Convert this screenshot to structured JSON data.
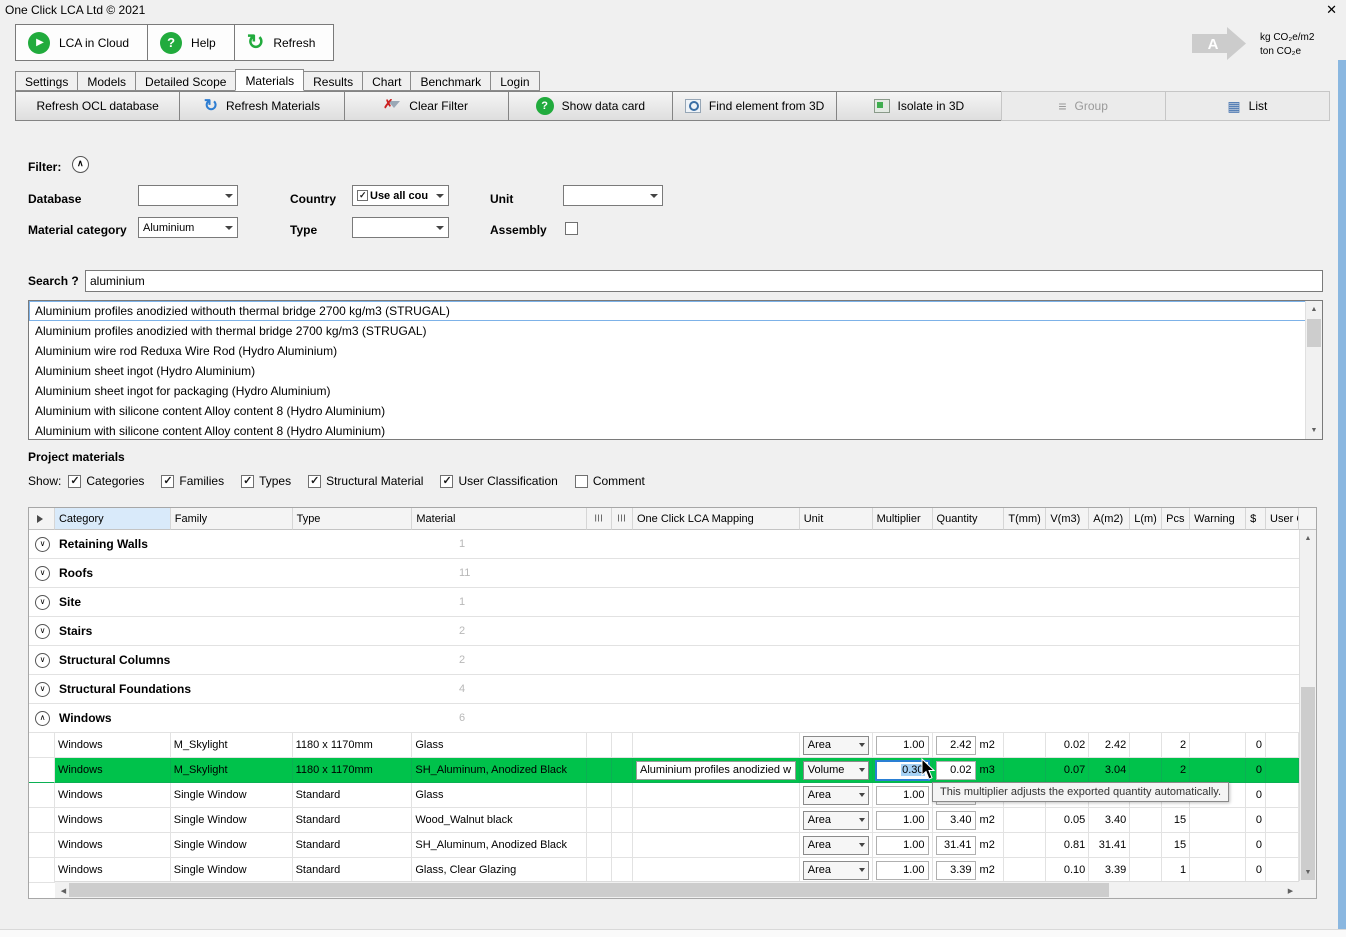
{
  "colors": {
    "brand_green": "#21ab3d",
    "row_highlight": "#00c24b",
    "focus_blue": "#2a7fd4",
    "strip_blue": "#8ab7e0"
  },
  "titlebar": {
    "title": "One Click LCA Ltd © 2021",
    "close_glyph": "✕"
  },
  "toolbar": {
    "lca_cloud_label": "LCA in Cloud",
    "help_label": "Help",
    "refresh_label": "Refresh",
    "logo_letter": "A",
    "unit_line_1": "kg CO₂e/m2",
    "unit_line_2": "ton CO₂e"
  },
  "tabs": {
    "settings": "Settings",
    "models": "Models",
    "detailed_scope": "Detailed Scope",
    "materials": "Materials",
    "results": "Results",
    "chart": "Chart",
    "benchmark": "Benchmark",
    "login": "Login"
  },
  "actions": {
    "refresh_ocl": "Refresh OCL database",
    "refresh_materials": "Refresh Materials",
    "clear_filter": "Clear Filter",
    "show_data_card": "Show data card",
    "find_element": "Find element from 3D",
    "isolate": "Isolate in 3D",
    "group": "Group",
    "list": "List"
  },
  "filter": {
    "section_label": "Filter:",
    "database_label": "Database",
    "database_value": "",
    "country_label": "Country",
    "country_value": "Use all cou",
    "unit_label": "Unit",
    "unit_value": "",
    "material_category_label": "Material category",
    "material_category_value": "Aluminium",
    "type_label": "Type",
    "type_value": "",
    "assembly_label": "Assembly"
  },
  "search": {
    "label": "Search ?",
    "value": "aluminium"
  },
  "results": [
    "Aluminium profiles anodizied withouth thermal bridge 2700 kg/m3 (STRUGAL)",
    "Aluminium profiles anodizied with thermal bridge 2700 kg/m3 (STRUGAL)",
    "Aluminium wire rod Reduxa Wire Rod (Hydro Aluminium)",
    "Aluminium sheet ingot (Hydro Aluminium)",
    "Aluminium sheet ingot for packaging (Hydro Aluminium)",
    "Aluminium with silicone content Alloy content  8 (Hydro Aluminium)",
    "Aluminium with silicone content Alloy content  8 (Hydro Aluminium)"
  ],
  "project": {
    "title": "Project materials",
    "show_label": "Show:",
    "toggle_categories": "Categories",
    "toggle_families": "Families",
    "toggle_types": "Types",
    "toggle_structural": "Structural Material",
    "toggle_user_class": "User Classification",
    "toggle_comment": "Comment"
  },
  "table": {
    "headers": {
      "category": "Category",
      "family": "Family",
      "type": "Type",
      "material": "Material",
      "flag1": "|||",
      "flag2": "|||",
      "mapping": "One Click LCA Mapping",
      "unit": "Unit",
      "multiplier": "Multiplier",
      "quantity": "Quantity",
      "t": "T(mm)",
      "v": "V(m3)",
      "a": "A(m2)",
      "l": "L(m)",
      "pcs": "Pcs",
      "warning": "Warning",
      "dollar": "$",
      "user": "User Cla"
    },
    "groups": [
      {
        "name": "Retaining Walls",
        "count": "1"
      },
      {
        "name": "Roofs",
        "count": "11"
      },
      {
        "name": "Site",
        "count": "1"
      },
      {
        "name": "Stairs",
        "count": "2"
      },
      {
        "name": "Structural Columns",
        "count": "2"
      },
      {
        "name": "Structural Foundations",
        "count": "4"
      },
      {
        "name": "Windows",
        "count": "6"
      }
    ],
    "rows": [
      {
        "category": "Windows",
        "family": "M_Skylight",
        "type": "1180 x 1170mm",
        "material": "Glass",
        "mapping": "",
        "unit": "Area",
        "multiplier": "1.00",
        "quantity": "2.42",
        "qunit": "m2",
        "t": "",
        "v": "0.02",
        "a": "2.42",
        "l": "",
        "pcs": "2",
        "warning": "",
        "dollar": "0"
      },
      {
        "category": "Windows",
        "family": "M_Skylight",
        "type": "1180 x 1170mm",
        "material": "SH_Aluminum, Anodized Black",
        "mapping": "Aluminium profiles anodizied w",
        "unit": "Volume",
        "multiplier": "0.30",
        "quantity": "0.02",
        "qunit": "m3",
        "t": "",
        "v": "0.07",
        "a": "3.04",
        "l": "",
        "pcs": "2",
        "warning": "",
        "dollar": "0"
      },
      {
        "category": "Windows",
        "family": "Single Window",
        "type": "Standard",
        "material": "Glass",
        "mapping": "",
        "unit": "Area",
        "multiplier": "1.00",
        "quantity": "",
        "qunit": "",
        "t": "",
        "v": "",
        "a": "",
        "l": "",
        "pcs": "",
        "warning": "",
        "dollar": "0"
      },
      {
        "category": "Windows",
        "family": "Single Window",
        "type": "Standard",
        "material": "Wood_Walnut black",
        "mapping": "",
        "unit": "Area",
        "multiplier": "1.00",
        "quantity": "3.40",
        "qunit": "m2",
        "t": "",
        "v": "0.05",
        "a": "3.40",
        "l": "",
        "pcs": "15",
        "warning": "",
        "dollar": "0"
      },
      {
        "category": "Windows",
        "family": "Single Window",
        "type": "Standard",
        "material": "SH_Aluminum, Anodized Black",
        "mapping": "",
        "unit": "Area",
        "multiplier": "1.00",
        "quantity": "31.41",
        "qunit": "m2",
        "t": "",
        "v": "0.81",
        "a": "31.41",
        "l": "",
        "pcs": "15",
        "warning": "",
        "dollar": "0"
      },
      {
        "category": "Windows",
        "family": "Single Window",
        "type": "Standard",
        "material": "Glass, Clear Glazing",
        "mapping": "",
        "unit": "Area",
        "multiplier": "1.00",
        "quantity": "3.39",
        "qunit": "m2",
        "t": "",
        "v": "0.10",
        "a": "3.39",
        "l": "",
        "pcs": "1",
        "warning": "",
        "dollar": "0"
      }
    ],
    "tooltip": "This multiplier adjusts the exported quantity automatically."
  }
}
